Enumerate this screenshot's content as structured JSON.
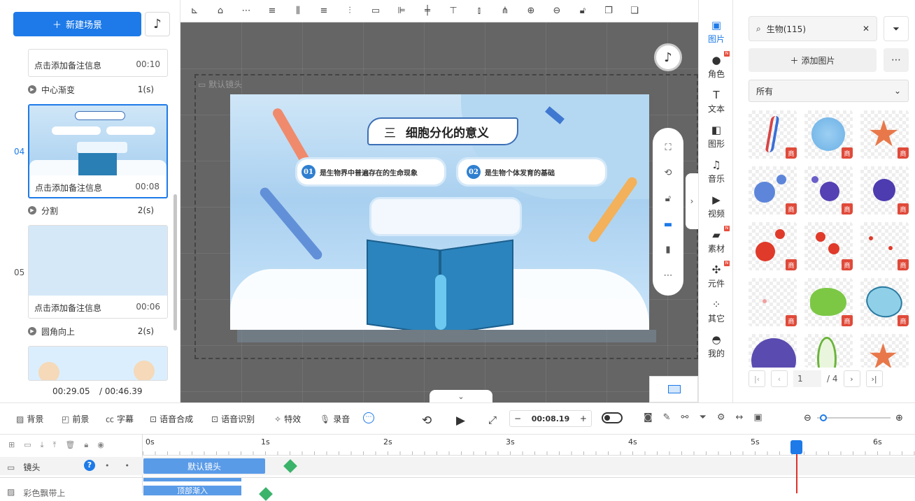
{
  "left_panel": {
    "new_scene_label": "新建场景",
    "scenes": [
      {
        "note": "点击添加备注信息",
        "duration": "00:10"
      },
      {
        "index": "04",
        "note": "点击添加备注信息",
        "duration": "00:08"
      },
      {
        "index": "05",
        "note": "点击添加备注信息",
        "duration": "00:06"
      }
    ],
    "transitions": [
      {
        "name": "中心渐变",
        "value": "1(s)"
      },
      {
        "name": "分割",
        "value": "2(s)"
      },
      {
        "name": "圆角向上",
        "value": "2(s)"
      }
    ],
    "current_time": "00:29.05",
    "total_time": "/ 00:46.39"
  },
  "canvas": {
    "camera_label": "默认镜头",
    "slide": {
      "title_num": "三",
      "title": "细胞分化的意义",
      "point1_num": "01",
      "point1": "是生物界中普遍存在的生命现象",
      "point2_num": "02",
      "point2": "是生物个体发育的基础"
    }
  },
  "side_tabs": [
    {
      "label": "图片",
      "icon": "image-icon"
    },
    {
      "label": "角色",
      "icon": "person-icon"
    },
    {
      "label": "文本",
      "icon": "text-icon"
    },
    {
      "label": "图形",
      "icon": "shape-icon"
    },
    {
      "label": "音乐",
      "icon": "music-icon"
    },
    {
      "label": "视频",
      "icon": "video-icon"
    },
    {
      "label": "素材",
      "icon": "folder-icon"
    },
    {
      "label": "元件",
      "icon": "pinwheel-icon"
    },
    {
      "label": "其它",
      "icon": "grid-icon"
    },
    {
      "label": "我的",
      "icon": "user-icon"
    }
  ],
  "assets": {
    "search_value": "生物(115)",
    "add_label": "添加图片",
    "filter_value": "所有",
    "badge": "商",
    "page_current": "1",
    "page_total": "/ 4"
  },
  "controls": {
    "background": "背景",
    "foreground": "前景",
    "subtitle": "字幕",
    "tts": "语音合成",
    "asr": "语音识别",
    "effects": "特效",
    "record": "录音",
    "time": "00:08.19"
  },
  "timeline": {
    "ticks": [
      "0s",
      "1s",
      "2s",
      "3s",
      "4s",
      "5s",
      "6s"
    ],
    "track1": "镜头",
    "track2": "彩色飘带上",
    "clip1": "默认镜头",
    "clip2": "顶部渐入"
  }
}
